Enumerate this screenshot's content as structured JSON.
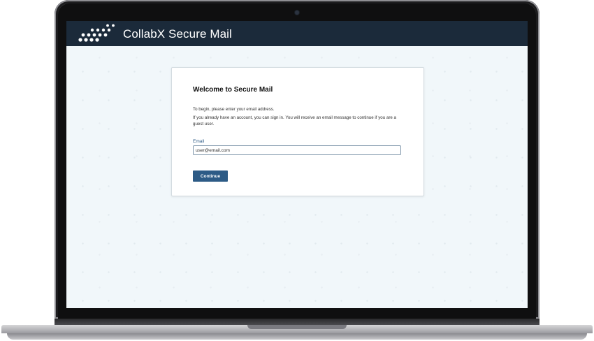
{
  "header": {
    "logo_icon": "collabx-dots-logo",
    "title": "CollabX Secure Mail",
    "background_color": "#1b2a3a"
  },
  "card": {
    "title": "Welcome to Secure Mail",
    "intro": "To begin, please enter your email address.",
    "note": "If you already have an account, you can sign in. You will receive an email message to continue if you are a guest user.",
    "email_label": "Email",
    "email_value": "user@email.com",
    "continue_label": "Continue"
  },
  "colors": {
    "accent": "#2d5b86",
    "screen_background": "#f1f7fa"
  }
}
